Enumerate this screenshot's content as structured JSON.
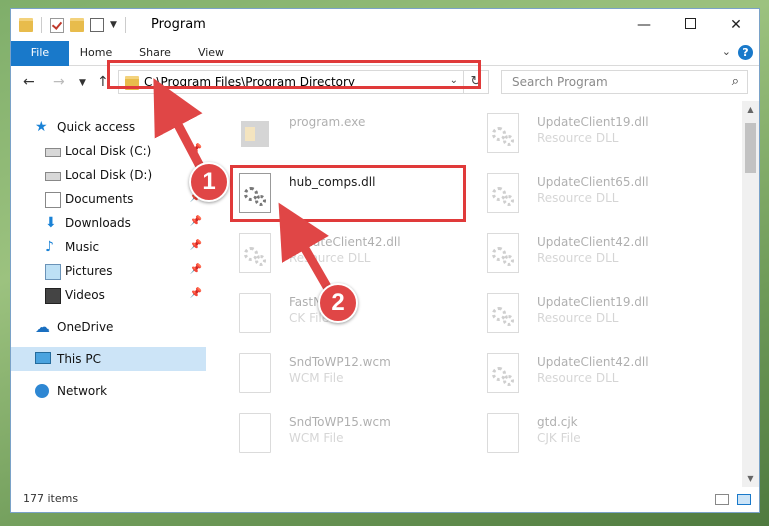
{
  "window": {
    "title": "Program",
    "controls": {
      "minimize": "—",
      "close": "✕"
    }
  },
  "ribbon": {
    "tabs": [
      "File",
      "Home",
      "Share",
      "View"
    ],
    "help": "?"
  },
  "address": {
    "path": "C:\\Program Files\\Program Directory"
  },
  "search": {
    "placeholder": "Search Program"
  },
  "sidebar": {
    "items": [
      {
        "label": "Quick access",
        "icon": "star-icon",
        "pinned": false
      },
      {
        "label": "Local Disk (C:)",
        "icon": "drive-icon",
        "pinned": true
      },
      {
        "label": "Local Disk (D:)",
        "icon": "drive-icon",
        "pinned": true
      },
      {
        "label": "Documents",
        "icon": "documents-icon",
        "pinned": true
      },
      {
        "label": "Downloads",
        "icon": "downloads-icon",
        "pinned": true
      },
      {
        "label": "Music",
        "icon": "music-icon",
        "pinned": true
      },
      {
        "label": "Pictures",
        "icon": "pictures-icon",
        "pinned": true
      },
      {
        "label": "Videos",
        "icon": "videos-icon",
        "pinned": true
      },
      {
        "label": "OneDrive",
        "icon": "cloud-icon",
        "pinned": false
      },
      {
        "label": "This PC",
        "icon": "computer-icon",
        "pinned": false,
        "selected": true
      },
      {
        "label": "Network",
        "icon": "network-icon",
        "pinned": false
      }
    ]
  },
  "files": [
    {
      "name": "program.exe",
      "type": "",
      "icon": "exe-icon"
    },
    {
      "name": "UpdateClient19.dll",
      "type": "Resource DLL",
      "icon": "dll-icon"
    },
    {
      "name": "hub_comps.dll",
      "type": "",
      "icon": "dll-icon"
    },
    {
      "name": "UpdateClient65.dll",
      "type": "Resource DLL",
      "icon": "dll-icon"
    },
    {
      "name": "UpdateClient42.dll",
      "type": "Resource DLL",
      "icon": "dll-icon"
    },
    {
      "name": "UpdateClient42.dll",
      "type": "Resource DLL",
      "icon": "dll-icon"
    },
    {
      "name": "FastN",
      "type": "CK File",
      "icon": "file-icon"
    },
    {
      "name": "UpdateClient19.dll",
      "type": "Resource DLL",
      "icon": "dll-icon"
    },
    {
      "name": "SndToWP12.wcm",
      "type": "WCM File",
      "icon": "file-icon"
    },
    {
      "name": "UpdateClient42.dll",
      "type": "Resource DLL",
      "icon": "dll-icon"
    },
    {
      "name": "SndToWP15.wcm",
      "type": "WCM File",
      "icon": "file-icon"
    },
    {
      "name": "gtd.cjk",
      "type": "CJK File",
      "icon": "file-icon"
    }
  ],
  "status": {
    "count": "177 items"
  },
  "annotations": {
    "step1": "1",
    "step2": "2",
    "color": "#e04646"
  }
}
